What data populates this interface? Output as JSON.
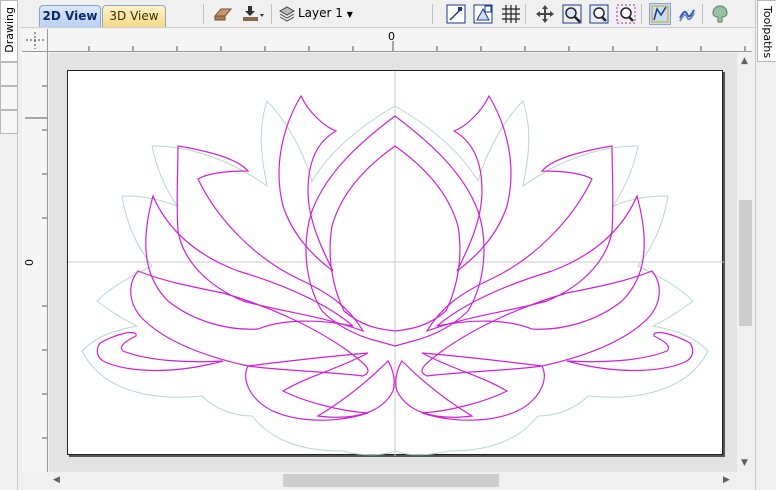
{
  "tabs": {
    "view_2d": "2D View",
    "view_3d": "3D View"
  },
  "toolbar": {
    "layer_label": "Layer 1",
    "icons": [
      "material-setup-icon",
      "import-icon",
      "layer-stack-icon",
      "snap-icon",
      "grid-snap-icon",
      "grid-icon",
      "pan-icon",
      "zoom-box-icon",
      "zoom-extents-icon",
      "zoom-selection-icon",
      "draw-vectors-icon",
      "toolpath-preview-icon",
      "model-icon"
    ]
  },
  "side_panels": {
    "left_tab": "Drawing",
    "right_tab": "Toolpaths"
  },
  "rulers": {
    "top_zero_label": "0",
    "left_zero_label": "0"
  },
  "colors": {
    "vector_color": "#d020d8",
    "offset_color": "#b8d8cc",
    "active_tab": "#c9daf8",
    "inactive_tab": "#fce9a8"
  }
}
